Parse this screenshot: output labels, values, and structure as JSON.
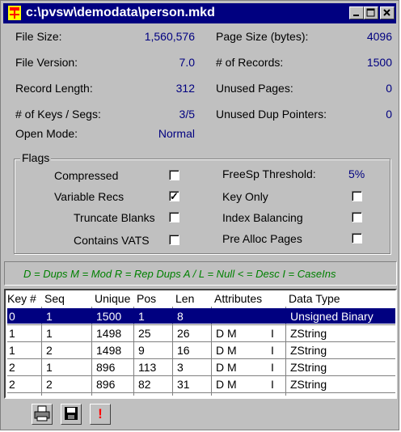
{
  "window": {
    "title": "c:\\pvsw\\demodata\\person.mkd"
  },
  "info": {
    "left": [
      {
        "label": "File Size:",
        "value": "1,560,576"
      },
      {
        "label": "File Version:",
        "value": "7.0"
      },
      {
        "label": "Record Length:",
        "value": "312"
      },
      {
        "label": "# of Keys / Segs:",
        "value": "3/5"
      },
      {
        "label": "Open Mode:",
        "value": "Normal"
      }
    ],
    "right": [
      {
        "label": "Page Size (bytes):",
        "value": "4096"
      },
      {
        "label": "# of Records:",
        "value": "1500"
      },
      {
        "label": "Unused Pages:",
        "value": "0"
      },
      {
        "label": "Unused Dup Pointers:",
        "value": "0"
      }
    ]
  },
  "flags": {
    "title": "Flags",
    "left": [
      {
        "label": "Compressed",
        "checked": false
      },
      {
        "label": "Variable Recs",
        "checked": true
      },
      {
        "label": "Truncate Blanks",
        "checked": false
      },
      {
        "label": "Contains VATS",
        "checked": false
      }
    ],
    "freesp_label": "FreeSp Threshold:",
    "freesp_value": "5%",
    "right": [
      {
        "label": "Key Only",
        "checked": false
      },
      {
        "label": "Index Balancing",
        "checked": false
      },
      {
        "label": "Pre Alloc Pages",
        "checked": false
      }
    ]
  },
  "legend": "D = Dups   M = Mod   R = Rep  Dups   A / L = Null   < = Desc   I = CaseIns",
  "table": {
    "columns": [
      "Key #",
      "Seq",
      "Unique",
      "Pos",
      "Len",
      "Attributes",
      "Data Type"
    ],
    "rows": [
      [
        "0",
        "1",
        "1500",
        "1",
        "8",
        "",
        "",
        "Unsigned Binary"
      ],
      [
        "1",
        "1",
        "1498",
        "25",
        "26",
        "D M",
        "I",
        "ZString"
      ],
      [
        "1",
        "2",
        "1498",
        "9",
        "16",
        "D M",
        "I",
        "ZString"
      ],
      [
        "2",
        "1",
        "896",
        "113",
        "3",
        "D M",
        "I",
        "ZString"
      ],
      [
        "2",
        "2",
        "896",
        "82",
        "31",
        "D M",
        "I",
        "ZString"
      ]
    ],
    "selected_row": 0
  },
  "toolbar": {
    "print_icon": "printer-icon",
    "save_icon": "floppy-disk-icon",
    "alert_icon": "exclamation-icon",
    "alert_glyph": "!"
  },
  "colors": {
    "titlebar": "#000080",
    "value_text": "#000080",
    "legend_text": "#008000",
    "selection": "#000080"
  }
}
